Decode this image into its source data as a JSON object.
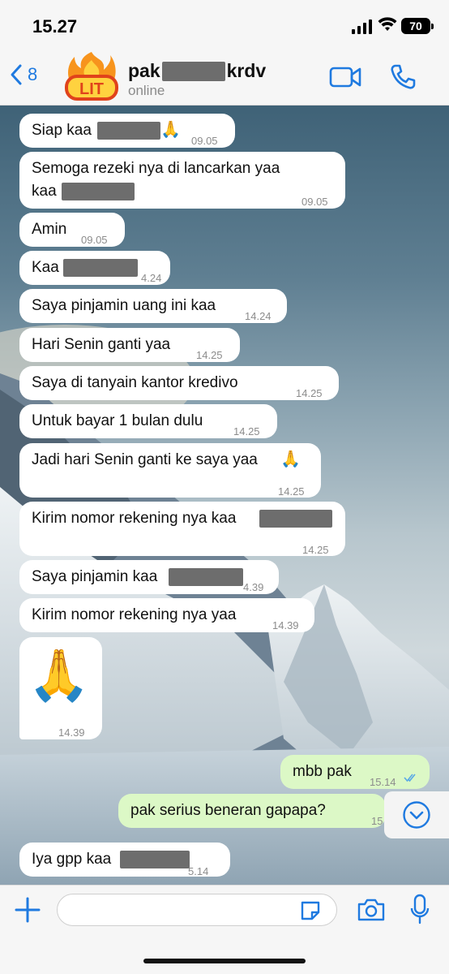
{
  "status_bar": {
    "time": "15.27",
    "battery": "70"
  },
  "header": {
    "back_count": "8",
    "avatar_text": "LIT",
    "name_prefix": "pak",
    "name_suffix": "krdv",
    "status": "online"
  },
  "messages": [
    {
      "text": "Siap kaa",
      "time": "09.05",
      "emoji": "🙏"
    },
    {
      "text": "Semoga rezeki nya di lancarkan yaa",
      "text2": "kaa",
      "time": "09.05"
    },
    {
      "text": "Amin",
      "time": "09.05"
    },
    {
      "text": "Kaa",
      "time": "4.24"
    },
    {
      "text": "Saya pinjamin uang ini kaa",
      "time": "14.24"
    },
    {
      "text": "Hari Senin ganti yaa",
      "time": "14.25"
    },
    {
      "text": "Saya di tanyain kantor kredivo",
      "time": "14.25"
    },
    {
      "text": "Untuk bayar 1 bulan dulu",
      "time": "14.25"
    },
    {
      "text": "Jadi hari Senin ganti ke saya yaa",
      "time": "14.25",
      "emoji": "🙏"
    },
    {
      "text": "Kirim nomor rekening nya kaa",
      "time": "14.25"
    },
    {
      "text": "Saya pinjamin kaa",
      "time": "4.39"
    },
    {
      "text": "Kirim nomor rekening nya yaa",
      "time": "14.39"
    },
    {
      "emoji": "🙏",
      "time": "14.39"
    },
    {
      "text": "mbb pak",
      "time": "15.14",
      "outgoing": true
    },
    {
      "text": "pak serius beneran gapapa?",
      "time": "15",
      "outgoing": true
    },
    {
      "text": "Iya gpp kaa",
      "time": "5.14"
    }
  ],
  "input": {
    "placeholder": ""
  },
  "colors": {
    "accent": "#1f7ae0",
    "incoming_bubble": "#ffffff",
    "outgoing_bubble": "#dcf8c6",
    "redaction": "#6d6d6d"
  }
}
